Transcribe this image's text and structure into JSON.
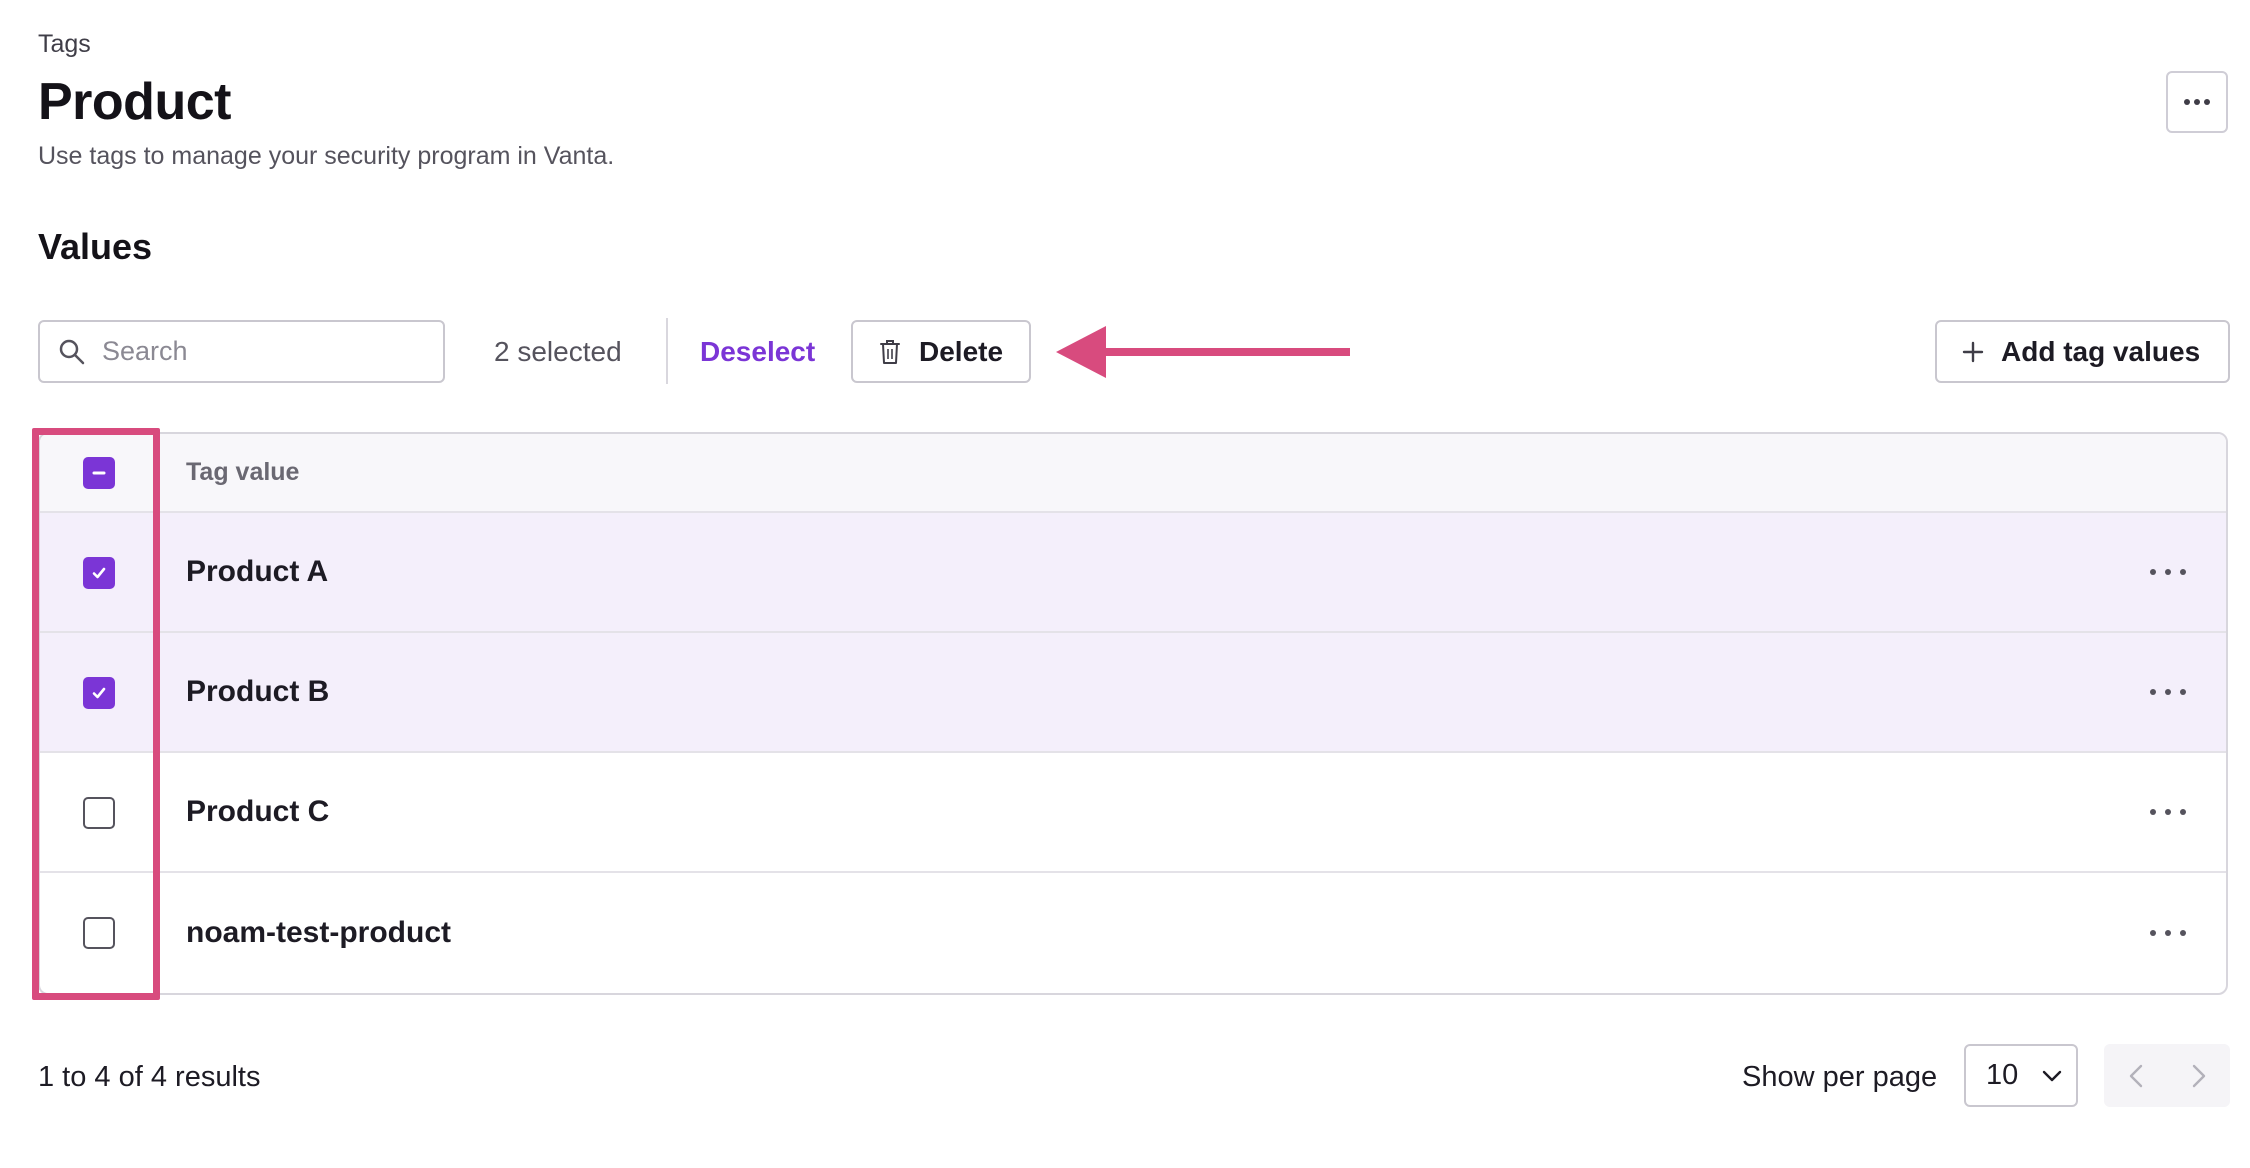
{
  "header": {
    "breadcrumb": "Tags",
    "title": "Product",
    "description": "Use tags to manage your security program in Vanta.",
    "more_icon": "more-horizontal-icon"
  },
  "values_section": {
    "title": "Values",
    "search": {
      "placeholder": "Search",
      "value": "",
      "icon": "search-icon"
    },
    "selected_count": "2 selected",
    "deselect_label": "Deselect",
    "delete_label": "Delete",
    "delete_icon": "trash-icon",
    "add_label": "Add tag values",
    "add_icon": "plus-icon",
    "annotation_color": "#d84b7e"
  },
  "table": {
    "header_checkbox_state": "indeterminate",
    "column_header": "Tag value",
    "rows": [
      {
        "value": "Product A",
        "checked": true
      },
      {
        "value": "Product B",
        "checked": true
      },
      {
        "value": "Product C",
        "checked": false
      },
      {
        "value": "noam-test-product",
        "checked": false
      }
    ]
  },
  "footer": {
    "results_text": "1 to 4 of 4 results",
    "per_page_label": "Show per page",
    "per_page_value": "10",
    "prev_icon": "chevron-left-icon",
    "next_icon": "chevron-right-icon"
  },
  "colors": {
    "accent": "#7b35d6",
    "selected_row": "#f4effb",
    "annotation": "#d84b7e"
  }
}
